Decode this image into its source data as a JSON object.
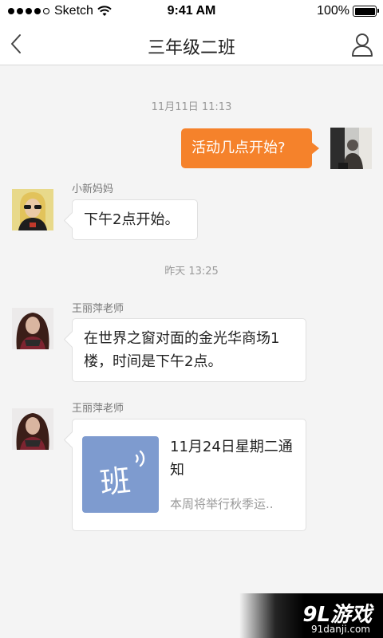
{
  "status_bar": {
    "carrier": "Sketch",
    "time": "9:41 AM",
    "battery": "100%",
    "battery_level": 1.0
  },
  "nav": {
    "title": "三年级二班",
    "back_icon": "chevron-left-icon",
    "profile_icon": "user-icon"
  },
  "messages": [
    {
      "type": "timestamp",
      "text": "11月11日 11:13"
    },
    {
      "type": "outgoing",
      "text": "活动几点开始?"
    },
    {
      "type": "incoming",
      "sender": "小新妈妈",
      "text": "下午2点开始。"
    },
    {
      "type": "timestamp",
      "text": "昨天 13:25"
    },
    {
      "type": "incoming",
      "sender": "王丽萍老师",
      "text": "在世界之窗对面的金光华商场1楼，时间是下午2点。"
    },
    {
      "type": "card",
      "sender": "王丽萍老师",
      "thumb_label": "班",
      "title": "11月24日星期二通知",
      "description": "本周将举行秋季运.."
    }
  ],
  "watermark": {
    "logo": "9L游戏",
    "url": "91danji.com"
  },
  "colors": {
    "accent": "#f5822b",
    "card_thumb": "#7e9bcf",
    "background": "#f4f4f4"
  }
}
